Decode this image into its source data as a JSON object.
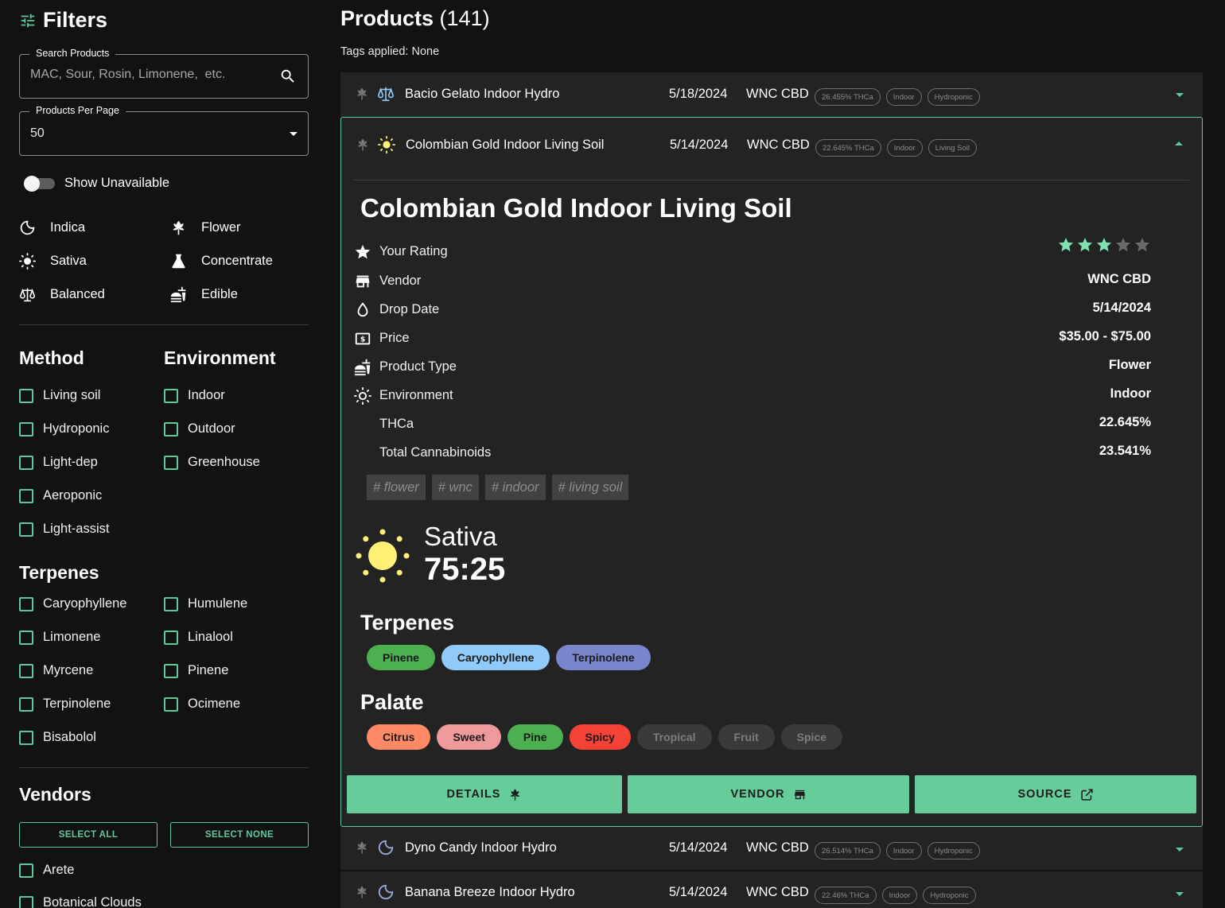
{
  "sidebar": {
    "title": "Filters",
    "search": {
      "label": "Search Products",
      "placeholder": "MAC, Sour, Rosin, Limonene,  etc."
    },
    "per_page": {
      "label": "Products Per Page",
      "value": "50"
    },
    "show_unavailable": "Show Unavailable",
    "categories": {
      "indica": "Indica",
      "sativa": "Sativa",
      "balanced": "Balanced",
      "flower": "Flower",
      "concentrate": "Concentrate",
      "edible": "Edible"
    },
    "method": {
      "title": "Method",
      "items": [
        "Living soil",
        "Hydroponic",
        "Light-dep",
        "Aeroponic",
        "Light-assist"
      ]
    },
    "environment": {
      "title": "Environment",
      "items": [
        "Indoor",
        "Outdoor",
        "Greenhouse"
      ]
    },
    "terpenes": {
      "title": "Terpenes",
      "items": [
        "Caryophyllene",
        "Humulene",
        "Limonene",
        "Linalool",
        "Myrcene",
        "Pinene",
        "Terpinolene",
        "Ocimene",
        "Bisabolol"
      ]
    },
    "vendors": {
      "title": "Vendors",
      "select_all": "SELECT ALL",
      "select_none": "SELECT NONE",
      "items": [
        "Arete",
        "Botanical Clouds"
      ]
    }
  },
  "main": {
    "title": "Products",
    "count": "(141)",
    "tags_applied": "Tags applied: None",
    "products": [
      {
        "name": "Bacio Gelato Indoor Hydro",
        "date": "5/18/2024",
        "vendor": "WNC CBD",
        "badges": [
          "26.455% THCa",
          "Indoor",
          "Hydroponic"
        ],
        "type_icon": "balance-scale-icon"
      },
      {
        "name": "Colombian Gold Indoor Living Soil",
        "date": "5/14/2024",
        "vendor": "WNC CBD",
        "badges": [
          "22.645% THCa",
          "Indoor",
          "Living Soil"
        ],
        "type_icon": "sun-icon"
      },
      {
        "name": "Dyno Candy Indoor Hydro",
        "date": "5/14/2024",
        "vendor": "WNC CBD",
        "badges": [
          "26.514% THCa",
          "Indoor",
          "Hydroponic"
        ],
        "type_icon": "moon-icon"
      },
      {
        "name": "Banana Breeze Indoor Hydro",
        "date": "5/14/2024",
        "vendor": "WNC CBD",
        "badges": [
          "22.46% THCa",
          "Indoor",
          "Hydroponic"
        ],
        "type_icon": "moon-icon"
      }
    ],
    "detail": {
      "title": "Colombian Gold Indoor Living Soil",
      "rating": 3,
      "rating_max": 5,
      "labels": {
        "rating": "Your Rating",
        "vendor": "Vendor",
        "drop_date": "Drop Date",
        "price": "Price",
        "product_type": "Product Type",
        "environment": "Environment",
        "thca": "THCa",
        "total": "Total Cannabinoids"
      },
      "values": {
        "vendor": "WNC CBD",
        "drop_date": "5/14/2024",
        "price": "$35.00 - $75.00",
        "product_type": "Flower",
        "environment": "Indoor",
        "thca": "22.645%",
        "total": "23.541%"
      },
      "hashtags": [
        "# flower",
        "# wnc",
        "# indoor",
        "# living soil"
      ],
      "strain": {
        "name": "Sativa",
        "ratio": "75:25"
      },
      "terpenes_title": "Terpenes",
      "terpenes": [
        {
          "name": "Pinene",
          "color": "#4caf50"
        },
        {
          "name": "Caryophyllene",
          "color": "#90caf9"
        },
        {
          "name": "Terpinolene",
          "color": "#7986cb"
        }
      ],
      "palate_title": "Palate",
      "palate": [
        {
          "name": "Citrus",
          "color": "#ff8a65",
          "active": true
        },
        {
          "name": "Sweet",
          "color": "#ef9a9a",
          "active": true
        },
        {
          "name": "Pine",
          "color": "#4caf50",
          "active": true
        },
        {
          "name": "Spicy",
          "color": "#f44336",
          "active": true
        },
        {
          "name": "Tropical",
          "color": "#3a3a3a",
          "active": false
        },
        {
          "name": "Fruit",
          "color": "#3a3a3a",
          "active": false
        },
        {
          "name": "Spice",
          "color": "#3a3a3a",
          "active": false
        }
      ],
      "actions": {
        "details": "DETAILS",
        "vendor": "VENDOR",
        "source": "SOURCE"
      }
    }
  },
  "colors": {
    "accent": "#5ec99a",
    "button": "#66cc9a",
    "background": "#121212",
    "panel": "#232323",
    "star_on": "#7ee0b0",
    "star_off": "#6a6a6a",
    "sun": "#fff176"
  }
}
